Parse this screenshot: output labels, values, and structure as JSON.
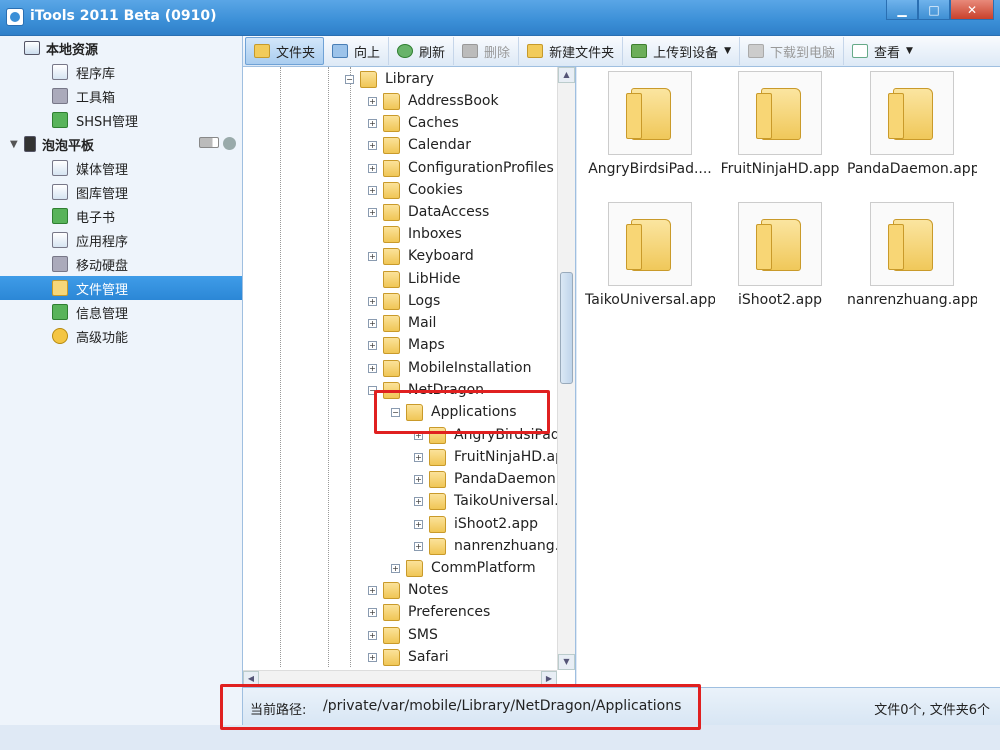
{
  "window": {
    "title": "iTools 2011 Beta (0910)",
    "minimize": "▁",
    "maximize": "□",
    "close": "✕"
  },
  "sidebar": {
    "local_group": "本地资源",
    "local_items": [
      {
        "label": "程序库",
        "icon": "app-library-icon"
      },
      {
        "label": "工具箱",
        "icon": "toolbox-icon"
      },
      {
        "label": "SHSH管理",
        "icon": "shsh-icon"
      }
    ],
    "device_group": "泡泡平板",
    "device_items": [
      {
        "label": "媒体管理",
        "icon": "media-icon"
      },
      {
        "label": "图库管理",
        "icon": "photo-icon"
      },
      {
        "label": "电子书",
        "icon": "ebook-icon"
      },
      {
        "label": "应用程序",
        "icon": "apps-icon"
      },
      {
        "label": "移动硬盘",
        "icon": "disk-icon"
      },
      {
        "label": "文件管理",
        "icon": "folder-icon"
      },
      {
        "label": "信息管理",
        "icon": "contacts-icon"
      },
      {
        "label": "高级功能",
        "icon": "star-icon"
      }
    ]
  },
  "toolbar": {
    "folder": "文件夹",
    "up": "向上",
    "refresh": "刷新",
    "delete": "删除",
    "new_folder": "新建文件夹",
    "upload": "上传到设备",
    "download": "下载到电脑",
    "view": "查看"
  },
  "tree": {
    "library": "Library",
    "children": [
      "AddressBook",
      "Caches",
      "Calendar",
      "ConfigurationProfiles",
      "Cookies",
      "DataAccess",
      "Inboxes",
      "Keyboard",
      "LibHide",
      "Logs",
      "Mail",
      "Maps",
      "MobileInstallation",
      "NetDragon"
    ],
    "applications": "Applications",
    "apps": [
      "AngryBirdsiPad",
      "FruitNinjaHD.ap",
      "PandaDaemon.",
      "TaikoUniversal.",
      "iShoot2.app",
      "nanrenzhuang.a"
    ],
    "after": [
      "CommPlatform",
      "Notes",
      "Preferences",
      "SMS",
      "Safari"
    ]
  },
  "files": [
    "AngryBirdsiPad....",
    "FruitNinjaHD.app",
    "PandaDaemon.app",
    "TaikoUniversal.app",
    "iShoot2.app",
    "nanrenzhuang.app"
  ],
  "status": {
    "path_label": "当前路径:",
    "path_value": "/private/var/mobile/Library/NetDragon/Applications",
    "count": "文件0个, 文件夹6个"
  },
  "colors": {
    "accent": "#2b87d6",
    "highlight_box": "#e02020",
    "folder": "#f0c656"
  }
}
